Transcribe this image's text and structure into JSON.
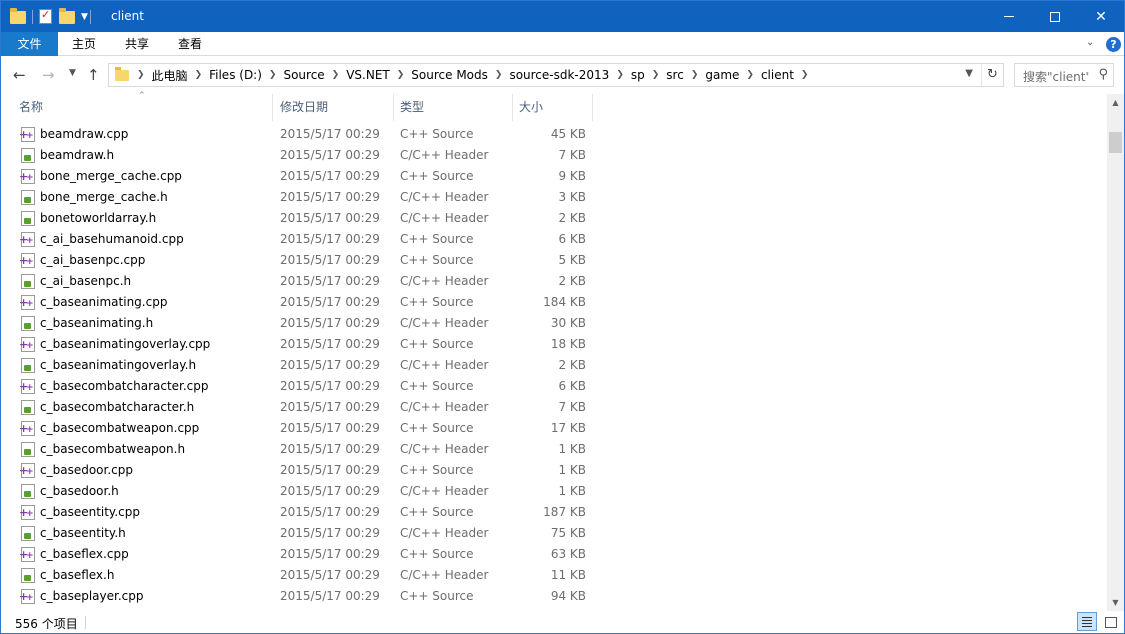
{
  "window": {
    "title": "client",
    "controls": {
      "minimize": "minimize",
      "maximize": "maximize",
      "close": "✕"
    }
  },
  "ribbon": {
    "tabs": [
      "文件",
      "主页",
      "共享",
      "查看"
    ],
    "help": "?"
  },
  "nav": {
    "back": "←",
    "forward": "→",
    "recent": "⌄",
    "up": "↑"
  },
  "address": {
    "crumbs": [
      "此电脑",
      "Files (D:)",
      "Source",
      "VS.NET",
      "Source Mods",
      "source-sdk-2013",
      "sp",
      "src",
      "game",
      "client"
    ]
  },
  "search": {
    "placeholder": "搜索\"client\""
  },
  "columns": {
    "name": "名称",
    "date": "修改日期",
    "type": "类型",
    "size": "大小"
  },
  "files": [
    {
      "name": "beamdraw.cpp",
      "date": "2015/5/17 00:29",
      "type": "C++ Source",
      "size": "45 KB",
      "icon": "cpp-file-icon"
    },
    {
      "name": "beamdraw.h",
      "date": "2015/5/17 00:29",
      "type": "C/C++ Header",
      "size": "7 KB",
      "icon": "header-file-icon"
    },
    {
      "name": "bone_merge_cache.cpp",
      "date": "2015/5/17 00:29",
      "type": "C++ Source",
      "size": "9 KB",
      "icon": "cpp-file-icon"
    },
    {
      "name": "bone_merge_cache.h",
      "date": "2015/5/17 00:29",
      "type": "C/C++ Header",
      "size": "3 KB",
      "icon": "header-file-icon"
    },
    {
      "name": "bonetoworldarray.h",
      "date": "2015/5/17 00:29",
      "type": "C/C++ Header",
      "size": "2 KB",
      "icon": "header-file-icon"
    },
    {
      "name": "c_ai_basehumanoid.cpp",
      "date": "2015/5/17 00:29",
      "type": "C++ Source",
      "size": "6 KB",
      "icon": "cpp-file-icon"
    },
    {
      "name": "c_ai_basenpc.cpp",
      "date": "2015/5/17 00:29",
      "type": "C++ Source",
      "size": "5 KB",
      "icon": "cpp-file-icon"
    },
    {
      "name": "c_ai_basenpc.h",
      "date": "2015/5/17 00:29",
      "type": "C/C++ Header",
      "size": "2 KB",
      "icon": "header-file-icon"
    },
    {
      "name": "c_baseanimating.cpp",
      "date": "2015/5/17 00:29",
      "type": "C++ Source",
      "size": "184 KB",
      "icon": "cpp-file-icon"
    },
    {
      "name": "c_baseanimating.h",
      "date": "2015/5/17 00:29",
      "type": "C/C++ Header",
      "size": "30 KB",
      "icon": "header-file-icon"
    },
    {
      "name": "c_baseanimatingoverlay.cpp",
      "date": "2015/5/17 00:29",
      "type": "C++ Source",
      "size": "18 KB",
      "icon": "cpp-file-icon"
    },
    {
      "name": "c_baseanimatingoverlay.h",
      "date": "2015/5/17 00:29",
      "type": "C/C++ Header",
      "size": "2 KB",
      "icon": "header-file-icon"
    },
    {
      "name": "c_basecombatcharacter.cpp",
      "date": "2015/5/17 00:29",
      "type": "C++ Source",
      "size": "6 KB",
      "icon": "cpp-file-icon"
    },
    {
      "name": "c_basecombatcharacter.h",
      "date": "2015/5/17 00:29",
      "type": "C/C++ Header",
      "size": "7 KB",
      "icon": "header-file-icon"
    },
    {
      "name": "c_basecombatweapon.cpp",
      "date": "2015/5/17 00:29",
      "type": "C++ Source",
      "size": "17 KB",
      "icon": "cpp-file-icon"
    },
    {
      "name": "c_basecombatweapon.h",
      "date": "2015/5/17 00:29",
      "type": "C/C++ Header",
      "size": "1 KB",
      "icon": "header-file-icon"
    },
    {
      "name": "c_basedoor.cpp",
      "date": "2015/5/17 00:29",
      "type": "C++ Source",
      "size": "1 KB",
      "icon": "cpp-file-icon"
    },
    {
      "name": "c_basedoor.h",
      "date": "2015/5/17 00:29",
      "type": "C/C++ Header",
      "size": "1 KB",
      "icon": "header-file-icon"
    },
    {
      "name": "c_baseentity.cpp",
      "date": "2015/5/17 00:29",
      "type": "C++ Source",
      "size": "187 KB",
      "icon": "cpp-file-icon"
    },
    {
      "name": "c_baseentity.h",
      "date": "2015/5/17 00:29",
      "type": "C/C++ Header",
      "size": "75 KB",
      "icon": "header-file-icon"
    },
    {
      "name": "c_baseflex.cpp",
      "date": "2015/5/17 00:29",
      "type": "C++ Source",
      "size": "63 KB",
      "icon": "cpp-file-icon"
    },
    {
      "name": "c_baseflex.h",
      "date": "2015/5/17 00:29",
      "type": "C/C++ Header",
      "size": "11 KB",
      "icon": "header-file-icon"
    },
    {
      "name": "c_baseplayer.cpp",
      "date": "2015/5/17 00:29",
      "type": "C++ Source",
      "size": "94 KB",
      "icon": "cpp-file-icon"
    }
  ],
  "status": {
    "count": "556 个项目"
  },
  "colors": {
    "titlebar": "#0f62be",
    "file_tab": "#1979ca",
    "header_text": "#4c607a",
    "detail_text": "#6d6d6d"
  }
}
